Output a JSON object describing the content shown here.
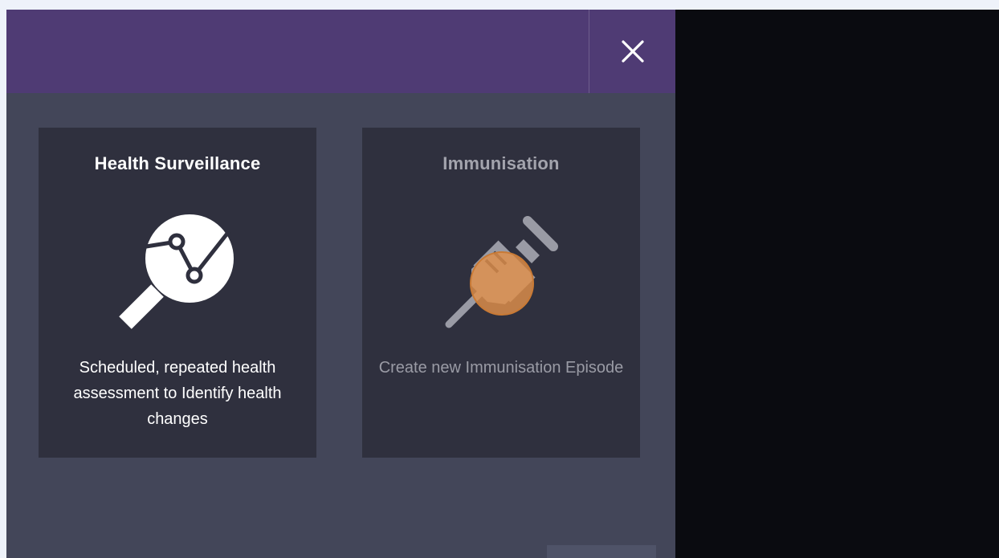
{
  "header": {
    "close_icon": "close-icon"
  },
  "cards": [
    {
      "title": "Health Surveillance",
      "icon": "magnifier-chart-icon",
      "description": "Scheduled, repeated health assessment to Identify health changes"
    },
    {
      "title": "Immunisation",
      "icon": "syringe-icon",
      "description": "Create new Immunisation Episode"
    }
  ],
  "colors": {
    "header": "#4f3b74",
    "modal_body": "#434659",
    "card": "#2f303e",
    "highlight": "#e0904a",
    "backdrop": "#0a0b10"
  }
}
